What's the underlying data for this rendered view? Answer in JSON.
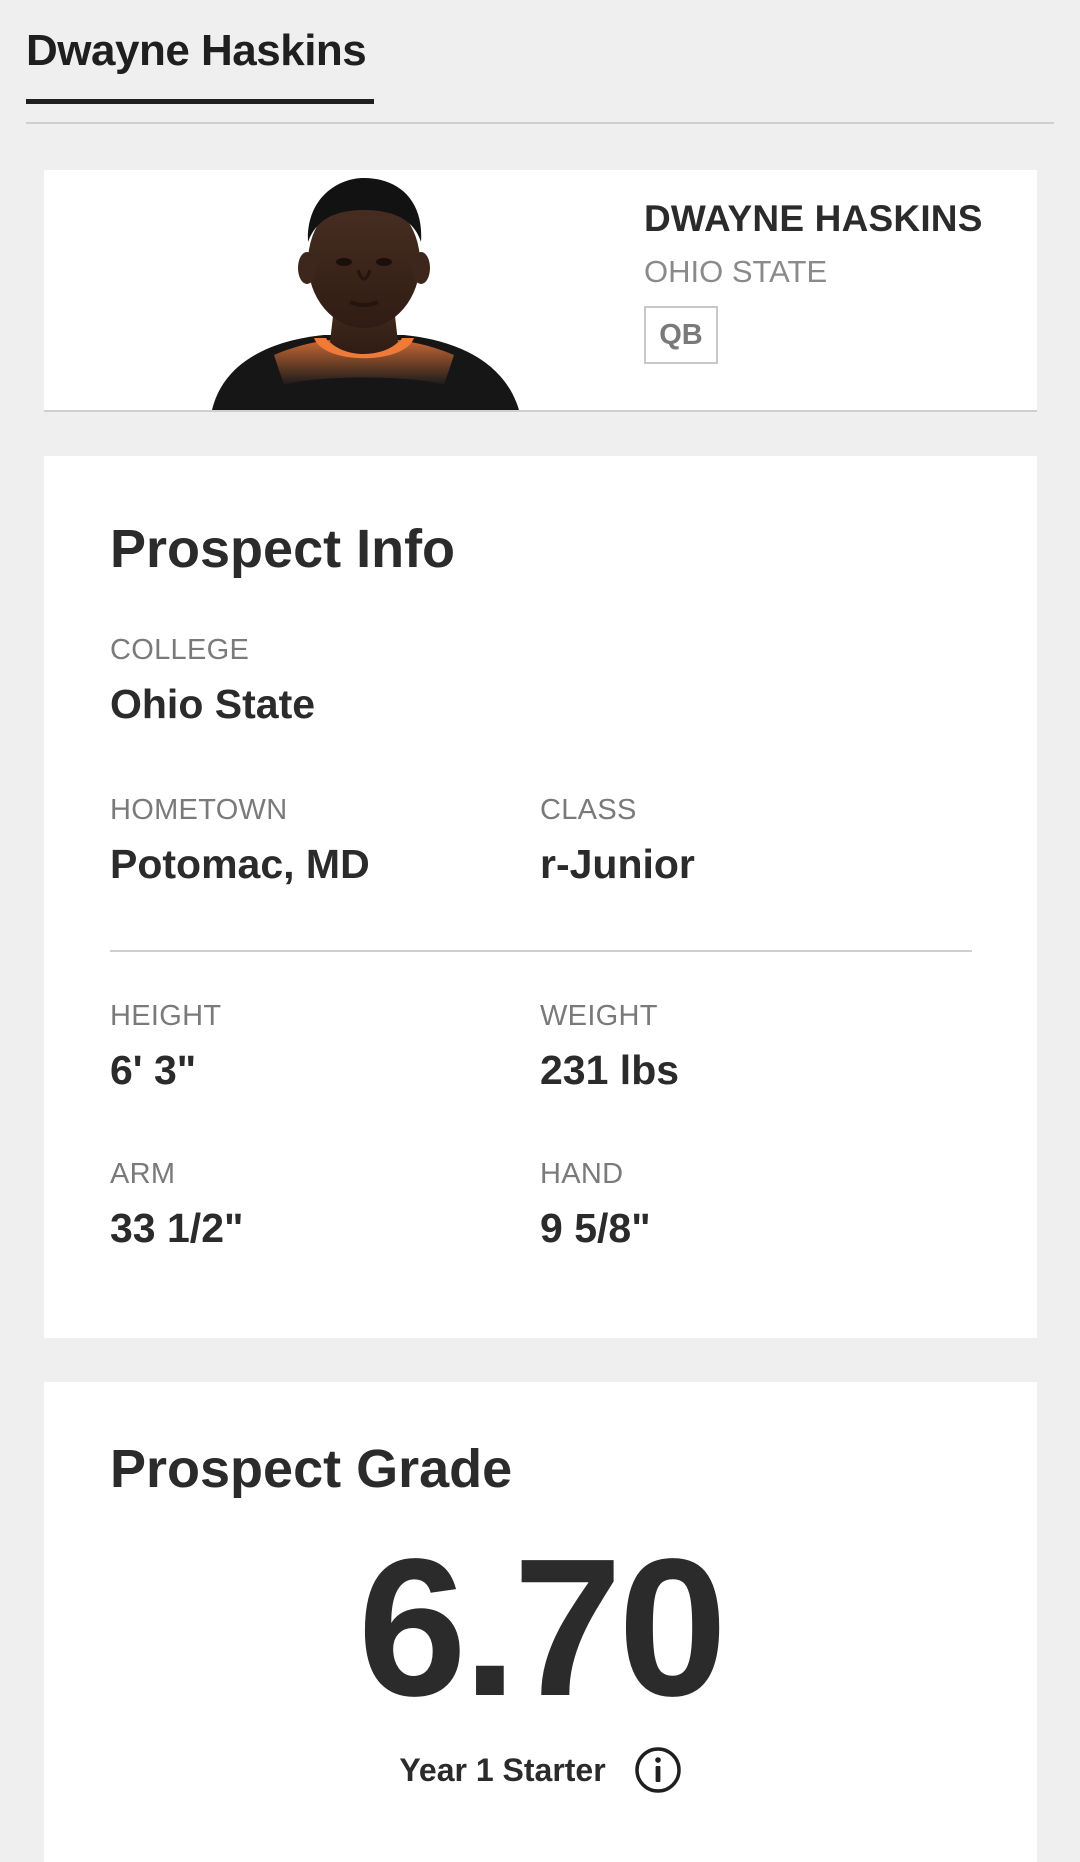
{
  "header": {
    "active_tab_label": "Dwayne Haskins"
  },
  "player": {
    "name": "DWAYNE HASKINS",
    "school": "OHIO STATE",
    "position": "QB",
    "photo_icon": "player-headshot"
  },
  "prospect_info": {
    "title": "Prospect Info",
    "college": {
      "label": "COLLEGE",
      "value": "Ohio State"
    },
    "hometown": {
      "label": "HOMETOWN",
      "value": "Potomac, MD"
    },
    "class": {
      "label": "CLASS",
      "value": "r-Junior"
    },
    "height": {
      "label": "HEIGHT",
      "value": "6' 3\""
    },
    "weight": {
      "label": "WEIGHT",
      "value": "231 lbs"
    },
    "arm": {
      "label": "ARM",
      "value": "33 1/2\""
    },
    "hand": {
      "label": "HAND",
      "value": "9 5/8\""
    }
  },
  "prospect_grade": {
    "title": "Prospect Grade",
    "value": "6.70",
    "description": "Year 1 Starter",
    "info_icon": "info-icon"
  }
}
